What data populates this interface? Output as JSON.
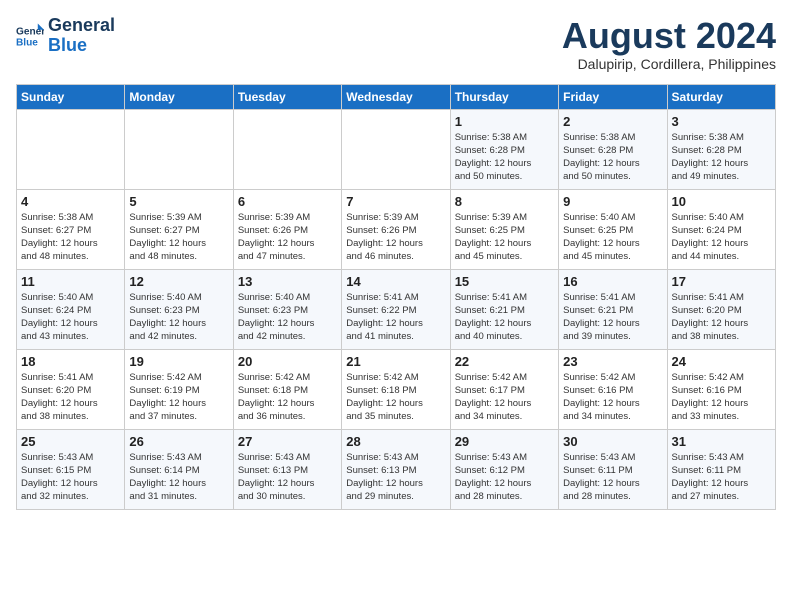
{
  "header": {
    "logo_line1": "General",
    "logo_line2": "Blue",
    "month_year": "August 2024",
    "location": "Dalupirip, Cordillera, Philippines"
  },
  "weekdays": [
    "Sunday",
    "Monday",
    "Tuesday",
    "Wednesday",
    "Thursday",
    "Friday",
    "Saturday"
  ],
  "weeks": [
    [
      {
        "day": "",
        "info": ""
      },
      {
        "day": "",
        "info": ""
      },
      {
        "day": "",
        "info": ""
      },
      {
        "day": "",
        "info": ""
      },
      {
        "day": "1",
        "info": "Sunrise: 5:38 AM\nSunset: 6:28 PM\nDaylight: 12 hours\nand 50 minutes."
      },
      {
        "day": "2",
        "info": "Sunrise: 5:38 AM\nSunset: 6:28 PM\nDaylight: 12 hours\nand 50 minutes."
      },
      {
        "day": "3",
        "info": "Sunrise: 5:38 AM\nSunset: 6:28 PM\nDaylight: 12 hours\nand 49 minutes."
      }
    ],
    [
      {
        "day": "4",
        "info": "Sunrise: 5:38 AM\nSunset: 6:27 PM\nDaylight: 12 hours\nand 48 minutes."
      },
      {
        "day": "5",
        "info": "Sunrise: 5:39 AM\nSunset: 6:27 PM\nDaylight: 12 hours\nand 48 minutes."
      },
      {
        "day": "6",
        "info": "Sunrise: 5:39 AM\nSunset: 6:26 PM\nDaylight: 12 hours\nand 47 minutes."
      },
      {
        "day": "7",
        "info": "Sunrise: 5:39 AM\nSunset: 6:26 PM\nDaylight: 12 hours\nand 46 minutes."
      },
      {
        "day": "8",
        "info": "Sunrise: 5:39 AM\nSunset: 6:25 PM\nDaylight: 12 hours\nand 45 minutes."
      },
      {
        "day": "9",
        "info": "Sunrise: 5:40 AM\nSunset: 6:25 PM\nDaylight: 12 hours\nand 45 minutes."
      },
      {
        "day": "10",
        "info": "Sunrise: 5:40 AM\nSunset: 6:24 PM\nDaylight: 12 hours\nand 44 minutes."
      }
    ],
    [
      {
        "day": "11",
        "info": "Sunrise: 5:40 AM\nSunset: 6:24 PM\nDaylight: 12 hours\nand 43 minutes."
      },
      {
        "day": "12",
        "info": "Sunrise: 5:40 AM\nSunset: 6:23 PM\nDaylight: 12 hours\nand 42 minutes."
      },
      {
        "day": "13",
        "info": "Sunrise: 5:40 AM\nSunset: 6:23 PM\nDaylight: 12 hours\nand 42 minutes."
      },
      {
        "day": "14",
        "info": "Sunrise: 5:41 AM\nSunset: 6:22 PM\nDaylight: 12 hours\nand 41 minutes."
      },
      {
        "day": "15",
        "info": "Sunrise: 5:41 AM\nSunset: 6:21 PM\nDaylight: 12 hours\nand 40 minutes."
      },
      {
        "day": "16",
        "info": "Sunrise: 5:41 AM\nSunset: 6:21 PM\nDaylight: 12 hours\nand 39 minutes."
      },
      {
        "day": "17",
        "info": "Sunrise: 5:41 AM\nSunset: 6:20 PM\nDaylight: 12 hours\nand 38 minutes."
      }
    ],
    [
      {
        "day": "18",
        "info": "Sunrise: 5:41 AM\nSunset: 6:20 PM\nDaylight: 12 hours\nand 38 minutes."
      },
      {
        "day": "19",
        "info": "Sunrise: 5:42 AM\nSunset: 6:19 PM\nDaylight: 12 hours\nand 37 minutes."
      },
      {
        "day": "20",
        "info": "Sunrise: 5:42 AM\nSunset: 6:18 PM\nDaylight: 12 hours\nand 36 minutes."
      },
      {
        "day": "21",
        "info": "Sunrise: 5:42 AM\nSunset: 6:18 PM\nDaylight: 12 hours\nand 35 minutes."
      },
      {
        "day": "22",
        "info": "Sunrise: 5:42 AM\nSunset: 6:17 PM\nDaylight: 12 hours\nand 34 minutes."
      },
      {
        "day": "23",
        "info": "Sunrise: 5:42 AM\nSunset: 6:16 PM\nDaylight: 12 hours\nand 34 minutes."
      },
      {
        "day": "24",
        "info": "Sunrise: 5:42 AM\nSunset: 6:16 PM\nDaylight: 12 hours\nand 33 minutes."
      }
    ],
    [
      {
        "day": "25",
        "info": "Sunrise: 5:43 AM\nSunset: 6:15 PM\nDaylight: 12 hours\nand 32 minutes."
      },
      {
        "day": "26",
        "info": "Sunrise: 5:43 AM\nSunset: 6:14 PM\nDaylight: 12 hours\nand 31 minutes."
      },
      {
        "day": "27",
        "info": "Sunrise: 5:43 AM\nSunset: 6:13 PM\nDaylight: 12 hours\nand 30 minutes."
      },
      {
        "day": "28",
        "info": "Sunrise: 5:43 AM\nSunset: 6:13 PM\nDaylight: 12 hours\nand 29 minutes."
      },
      {
        "day": "29",
        "info": "Sunrise: 5:43 AM\nSunset: 6:12 PM\nDaylight: 12 hours\nand 28 minutes."
      },
      {
        "day": "30",
        "info": "Sunrise: 5:43 AM\nSunset: 6:11 PM\nDaylight: 12 hours\nand 28 minutes."
      },
      {
        "day": "31",
        "info": "Sunrise: 5:43 AM\nSunset: 6:11 PM\nDaylight: 12 hours\nand 27 minutes."
      }
    ]
  ]
}
